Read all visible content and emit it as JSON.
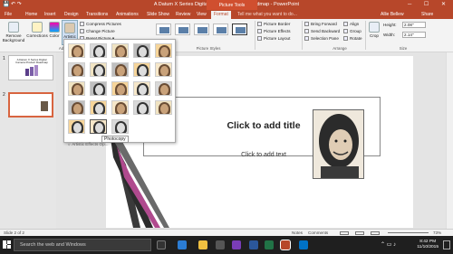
{
  "window": {
    "title": "A Datum X Series Digital Camera Product Roadmap - PowerPoint",
    "context_tab_group": "Picture Tools",
    "user": "Allie Bellew",
    "share": "Share"
  },
  "tabs": [
    "File",
    "Home",
    "Insert",
    "Design",
    "Transitions",
    "Animations",
    "Slide Show",
    "Review",
    "View",
    "Format"
  ],
  "tell_me": "Tell me what you want to do...",
  "ribbon": {
    "remove_background": "Remove Background",
    "corrections": "Corrections",
    "color": "Color",
    "artistic_effects": "Artistic Effects",
    "compress": "Compress Pictures",
    "change": "Change Picture",
    "reset": "Reset Picture",
    "picture_border": "Picture Border",
    "picture_effects": "Picture Effects",
    "picture_layout": "Picture Layout",
    "bring_forward": "Bring Forward",
    "send_backward": "Send Backward",
    "selection_pane": "Selection Pane",
    "align": "Align",
    "group": "Group",
    "rotate": "Rotate",
    "crop": "Crop",
    "height_label": "Height:",
    "height_value": "2.08\"",
    "width_label": "Width:",
    "width_value": "2.14\"",
    "groups": {
      "adjust": "Adj",
      "picture_styles": "Picture Styles",
      "arrange": "Arrange",
      "size": "Size"
    }
  },
  "gallery": {
    "tooltip": "Photocopy",
    "options_link": "Artistic Effects Op..."
  },
  "slides": [
    {
      "number": "1",
      "thumb_title": "A Datum X Series Digital Camera Product Roadmap"
    },
    {
      "number": "2"
    }
  ],
  "slide": {
    "title": "Click to add title",
    "body": "Click to add text"
  },
  "status": {
    "slide_info": "Slide 2 of 2",
    "notes": "Notes",
    "comments": "Comments",
    "zoom": "73%"
  },
  "taskbar": {
    "search_placeholder": "Search the web and Windows",
    "time": "8:42 PM",
    "date": "11/10/2015"
  },
  "colors": {
    "accent": "#b7472a",
    "taskbar": "#1f1f1f"
  }
}
